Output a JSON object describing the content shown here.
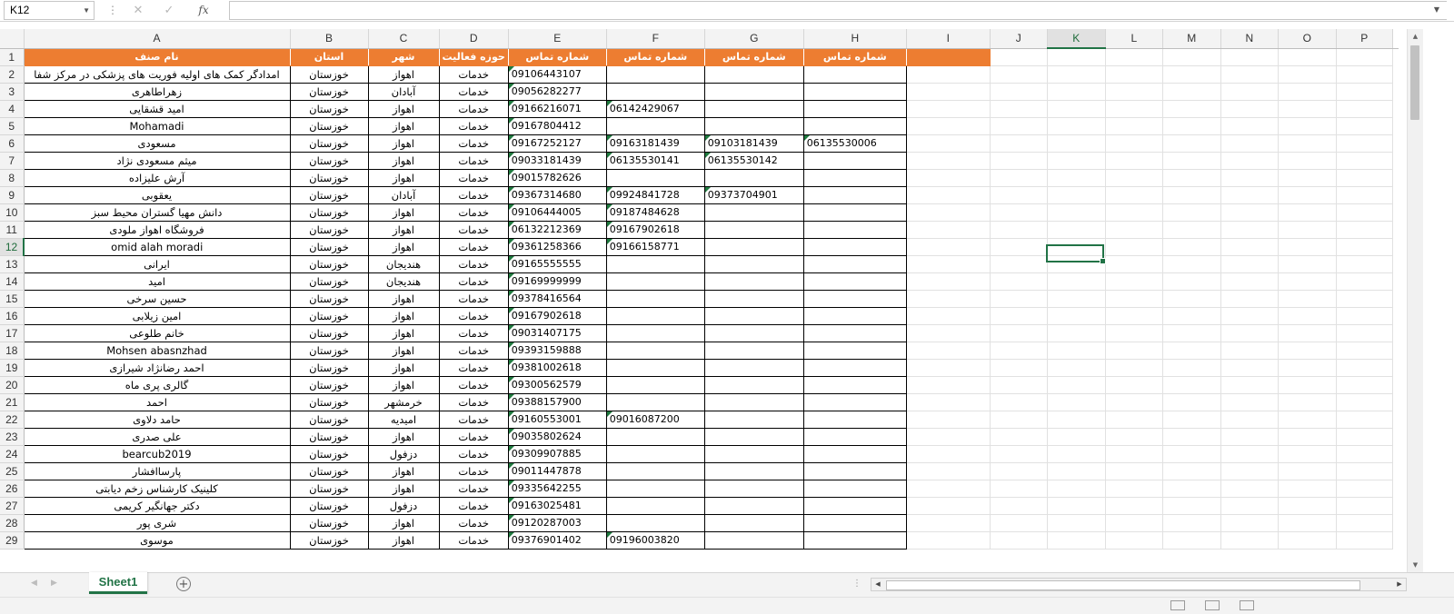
{
  "formula_bar": {
    "name_box": "K12",
    "fx_label": "fx",
    "formula_value": ""
  },
  "columns": [
    "A",
    "B",
    "C",
    "D",
    "E",
    "F",
    "G",
    "H",
    "I",
    "J",
    "K",
    "L",
    "M",
    "N",
    "O",
    "P"
  ],
  "selected_column": "K",
  "selected_row": 12,
  "selected_cell": "K12",
  "header_row": {
    "A": "نام صنف",
    "B": "استان",
    "C": "شهر",
    "D": "حوزه فعالیت",
    "E": "شماره تماس",
    "F": "شماره تماس",
    "G": "شماره تماس",
    "H": "شماره تماس"
  },
  "rows": [
    {
      "n": 2,
      "A": "امدادگر کمک های اولیه فوریت های پزشکی در مرکز شفا",
      "B": "خوزستان",
      "C": "اهواز",
      "D": "خدمات",
      "E": "09106443107",
      "F": "",
      "G": "",
      "H": ""
    },
    {
      "n": 3,
      "A": "زهراطاهری",
      "B": "خوزستان",
      "C": "آبادان",
      "D": "خدمات",
      "E": "09056282277",
      "F": "",
      "G": "",
      "H": ""
    },
    {
      "n": 4,
      "A": "امید قشقایی",
      "B": "خوزستان",
      "C": "اهواز",
      "D": "خدمات",
      "E": "09166216071",
      "F": "06142429067",
      "G": "",
      "H": ""
    },
    {
      "n": 5,
      "A": "Mohamadi",
      "B": "خوزستان",
      "C": "اهواز",
      "D": "خدمات",
      "E": "09167804412",
      "F": "",
      "G": "",
      "H": ""
    },
    {
      "n": 6,
      "A": "مسعودی",
      "B": "خوزستان",
      "C": "اهواز",
      "D": "خدمات",
      "E": "09167252127",
      "F": "09163181439",
      "G": "09103181439",
      "H": "06135530006"
    },
    {
      "n": 7,
      "A": "میثم مسعودی نژاد",
      "B": "خوزستان",
      "C": "اهواز",
      "D": "خدمات",
      "E": "09033181439",
      "F": "06135530141",
      "G": "06135530142",
      "H": ""
    },
    {
      "n": 8,
      "A": "آرش علیزاده",
      "B": "خوزستان",
      "C": "اهواز",
      "D": "خدمات",
      "E": "09015782626",
      "F": "",
      "G": "",
      "H": ""
    },
    {
      "n": 9,
      "A": "یعقوبی",
      "B": "خوزستان",
      "C": "آبادان",
      "D": "خدمات",
      "E": "09367314680",
      "F": "09924841728",
      "G": "09373704901",
      "H": ""
    },
    {
      "n": 10,
      "A": "دانش مهیا گستران محیط سبز",
      "B": "خوزستان",
      "C": "اهواز",
      "D": "خدمات",
      "E": "09106444005",
      "F": "09187484628",
      "G": "",
      "H": ""
    },
    {
      "n": 11,
      "A": "فروشگاه اهواز ملودی",
      "B": "خوزستان",
      "C": "اهواز",
      "D": "خدمات",
      "E": "06132212369",
      "F": "09167902618",
      "G": "",
      "H": ""
    },
    {
      "n": 12,
      "A": "omid alah moradi",
      "B": "خوزستان",
      "C": "اهواز",
      "D": "خدمات",
      "E": "09361258366",
      "F": "09166158771",
      "G": "",
      "H": ""
    },
    {
      "n": 13,
      "A": "ایرانی",
      "B": "خوزستان",
      "C": "هندیجان",
      "D": "خدمات",
      "E": "09165555555",
      "F": "",
      "G": "",
      "H": ""
    },
    {
      "n": 14,
      "A": "امید",
      "B": "خوزستان",
      "C": "هندیجان",
      "D": "خدمات",
      "E": "09169999999",
      "F": "",
      "G": "",
      "H": ""
    },
    {
      "n": 15,
      "A": "حسین سرخی",
      "B": "خوزستان",
      "C": "اهواز",
      "D": "خدمات",
      "E": "09378416564",
      "F": "",
      "G": "",
      "H": ""
    },
    {
      "n": 16,
      "A": "امین زیلابی",
      "B": "خوزستان",
      "C": "اهواز",
      "D": "خدمات",
      "E": "09167902618",
      "F": "",
      "G": "",
      "H": ""
    },
    {
      "n": 17,
      "A": "خانم طلوعی",
      "B": "خوزستان",
      "C": "اهواز",
      "D": "خدمات",
      "E": "09031407175",
      "F": "",
      "G": "",
      "H": ""
    },
    {
      "n": 18,
      "A": "Mohsen abasnzhad",
      "B": "خوزستان",
      "C": "اهواز",
      "D": "خدمات",
      "E": "09393159888",
      "F": "",
      "G": "",
      "H": ""
    },
    {
      "n": 19,
      "A": "احمد رضانژاد شیرازی",
      "B": "خوزستان",
      "C": "اهواز",
      "D": "خدمات",
      "E": "09381002618",
      "F": "",
      "G": "",
      "H": ""
    },
    {
      "n": 20,
      "A": "گالری پری ماه",
      "B": "خوزستان",
      "C": "اهواز",
      "D": "خدمات",
      "E": "09300562579",
      "F": "",
      "G": "",
      "H": ""
    },
    {
      "n": 21,
      "A": "احمد",
      "B": "خوزستان",
      "C": "خرمشهر",
      "D": "خدمات",
      "E": "09388157900",
      "F": "",
      "G": "",
      "H": ""
    },
    {
      "n": 22,
      "A": "حامد دلاوی",
      "B": "خوزستان",
      "C": "امیدیه",
      "D": "خدمات",
      "E": "09160553001",
      "F": "09016087200",
      "G": "",
      "H": ""
    },
    {
      "n": 23,
      "A": "علی صدری",
      "B": "خوزستان",
      "C": "اهواز",
      "D": "خدمات",
      "E": "09035802624",
      "F": "",
      "G": "",
      "H": ""
    },
    {
      "n": 24,
      "A": "bearcub2019",
      "B": "خوزستان",
      "C": "دزفول",
      "D": "خدمات",
      "E": "09309907885",
      "F": "",
      "G": "",
      "H": ""
    },
    {
      "n": 25,
      "A": "پارساافشار",
      "B": "خوزستان",
      "C": "اهواز",
      "D": "خدمات",
      "E": "09011447878",
      "F": "",
      "G": "",
      "H": ""
    },
    {
      "n": 26,
      "A": "کلینیک کارشناس زخم دیابتی",
      "B": "خوزستان",
      "C": "اهواز",
      "D": "خدمات",
      "E": "09335642255",
      "F": "",
      "G": "",
      "H": ""
    },
    {
      "n": 27,
      "A": "دکتر جهانگیر کریمی",
      "B": "خوزستان",
      "C": "دزفول",
      "D": "خدمات",
      "E": "09163025481",
      "F": "",
      "G": "",
      "H": ""
    },
    {
      "n": 28,
      "A": "شری پور",
      "B": "خوزستان",
      "C": "اهواز",
      "D": "خدمات",
      "E": "09120287003",
      "F": "",
      "G": "",
      "H": ""
    },
    {
      "n": 29,
      "A": "موسوی",
      "B": "خوزستان",
      "C": "اهواز",
      "D": "خدمات",
      "E": "09376901402",
      "F": "09196003820",
      "G": "",
      "H": ""
    }
  ],
  "sheet_tabs": [
    {
      "label": "Sheet1",
      "active": true
    }
  ],
  "colors": {
    "header_fill": "#ed7d31",
    "excel_green": "#217346",
    "grid_line": "#e1e1e1"
  }
}
